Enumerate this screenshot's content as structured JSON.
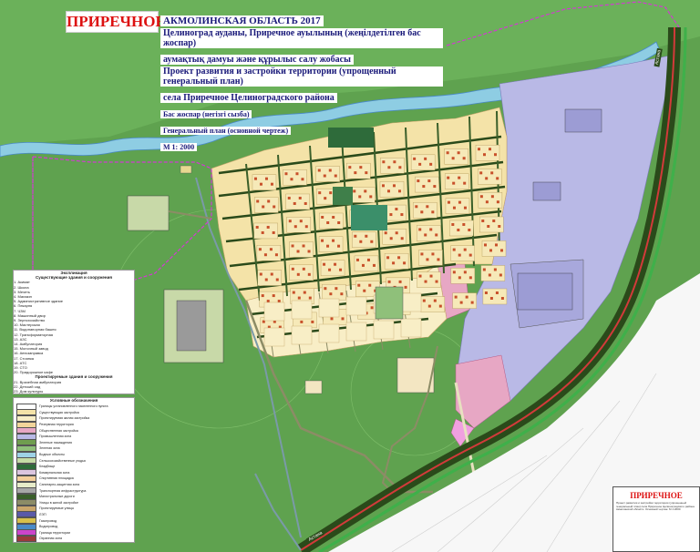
{
  "title": {
    "name": "ПРИРЕЧНОЕ",
    "region": "АКМОЛИНСКАЯ ОБЛАСТЬ 2017",
    "kaz_line1": "Целиноград ауданы, Приречное ауылының (жеңілдетілген бас жоспар)",
    "kaz_line2": "аумақтық дамуы және құрылыс салу жобасы",
    "rus_line1": "Проект развития и застройки территории (упрощенный генеральный план)",
    "rus_line2": "села Приречное Целиноградского района",
    "kaz_sub": "Бас жоспар (негізгі сызба)",
    "rus_sub": "Генеральный план (основной чертеж)",
    "scale": "М 1: 2000"
  },
  "explication": {
    "header": "Экспликация",
    "subheader": "Существующие здания и сооружения",
    "existing": [
      "1. Акимат",
      "2. Школа",
      "3. Мечеть",
      "4. Магазин",
      "5. Административное здание",
      "6. Пекарня",
      "7. ЧЗМ",
      "8. Машинный двор",
      "9. Зернохозяйство",
      "10. Мастерская",
      "11. Водонапорная башня",
      "12. Трансформаторная",
      "13. АЗС",
      "14. Амбулатория",
      "15. Молочный завод",
      "16. Автозаправка",
      "17. Стоянка",
      "18. АТС",
      "19. СТО",
      "20. Придорожное кафе"
    ],
    "subheader2": "Проектируемые здания и сооружения",
    "projected": [
      "21. Врачебная амбулатория",
      "22. Детский сад",
      "23. Дом культуры",
      "24. Очистные ДОКО",
      "25. Котельная на газовом топливе"
    ]
  },
  "legend": {
    "header": "Условные обозначения",
    "items": [
      {
        "label": "Границы установленного населенного пункта",
        "color": "#ffffff"
      },
      {
        "label": "Существующая застройка",
        "color": "#f4e3a8"
      },
      {
        "label": "Проектируемая жилая застройка",
        "color": "#f8eec6"
      },
      {
        "label": "Резервная территория",
        "color": "#f2d59a"
      },
      {
        "label": "Общественная застройка",
        "color": "#e7a7c4"
      },
      {
        "label": "Промышленная зона",
        "color": "#b9b9e6"
      },
      {
        "label": "Зеленые насаждения",
        "color": "#6f9e4f"
      },
      {
        "label": "Зеленая зона",
        "color": "#8fc07a"
      },
      {
        "label": "Водные объекты",
        "color": "#9ed2e6"
      },
      {
        "label": "Сельскохозяйственные угодья",
        "color": "#c5dba6"
      },
      {
        "label": "Кладбище",
        "color": "#2e6b3a"
      },
      {
        "label": "Коммунальная зона",
        "color": "#dcc6e0"
      },
      {
        "label": "Спортивная площадка",
        "color": "#f3cf9b"
      },
      {
        "label": "Санитарно-защитная зона",
        "color": "#e7ecc9"
      },
      {
        "label": "Транспортная инфраструктура",
        "color": "#a7a7a7"
      },
      {
        "label": "Магистральные дороги",
        "color": "#3a5f2a"
      },
      {
        "label": "Улицы в жилой застройке",
        "color": "#8c8c66"
      },
      {
        "label": "Проектируемые улицы",
        "color": "#c9a56b"
      },
      {
        "label": "ЛЭП",
        "color": "#5a5aa8"
      },
      {
        "label": "Газопровод",
        "color": "#d8c04a"
      },
      {
        "label": "Водопровод",
        "color": "#4a8ac8"
      },
      {
        "label": "Граница территории",
        "color": "#cc44cc"
      },
      {
        "label": "Охранная зона",
        "color": "#9a3a3a"
      }
    ]
  },
  "stamp": {
    "title": "ПРИРЕЧНОЕ",
    "note": "Проект развития и застройки территории (упрощенный генеральный план) села Приречное Целиноградского района Акмолинской области. Основной чертеж. М 1:2000"
  },
  "roads": {
    "label_top": "Астана",
    "label_bottom": "Астана"
  },
  "colors": {
    "background_green": "#5fa24f",
    "river": "#8ecde3",
    "residential": "#f4e3a8",
    "industrial": "#b9b9e6",
    "public": "#e7a7c4",
    "highway_red": "#d23a3a",
    "boundary_magenta": "#d23ad2"
  }
}
